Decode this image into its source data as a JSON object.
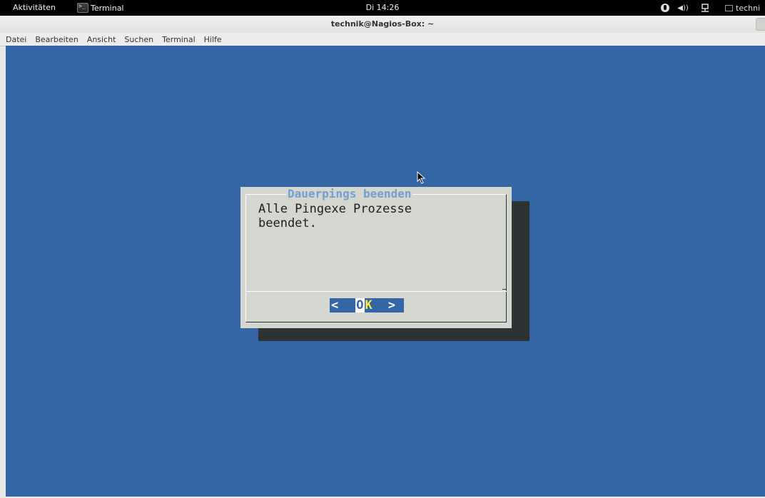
{
  "topbar": {
    "activities": "Aktivitäten",
    "app_name": "Terminal",
    "clock": "Di 14:26",
    "user": "techni"
  },
  "window": {
    "title": "technik@Nagios-Box: ~",
    "menu": [
      "Datei",
      "Bearbeiten",
      "Ansicht",
      "Suchen",
      "Terminal",
      "Hilfe"
    ]
  },
  "dialog": {
    "title": "Dauerpings beenden",
    "message": "Alle Pingexe Prozesse\nbeendet.",
    "button": {
      "left": "<",
      "o": "O",
      "k": "K",
      "right": ">"
    }
  },
  "colors": {
    "terminal_bg": "#3465a4",
    "dialog_bg": "#d3d7cf",
    "dialog_title": "#729fcf",
    "hotkey": "#fce94f"
  },
  "icons": [
    "terminal-icon",
    "accessibility-icon",
    "volume-icon",
    "network-icon",
    "user-icon",
    "mouse-pointer-icon"
  ]
}
